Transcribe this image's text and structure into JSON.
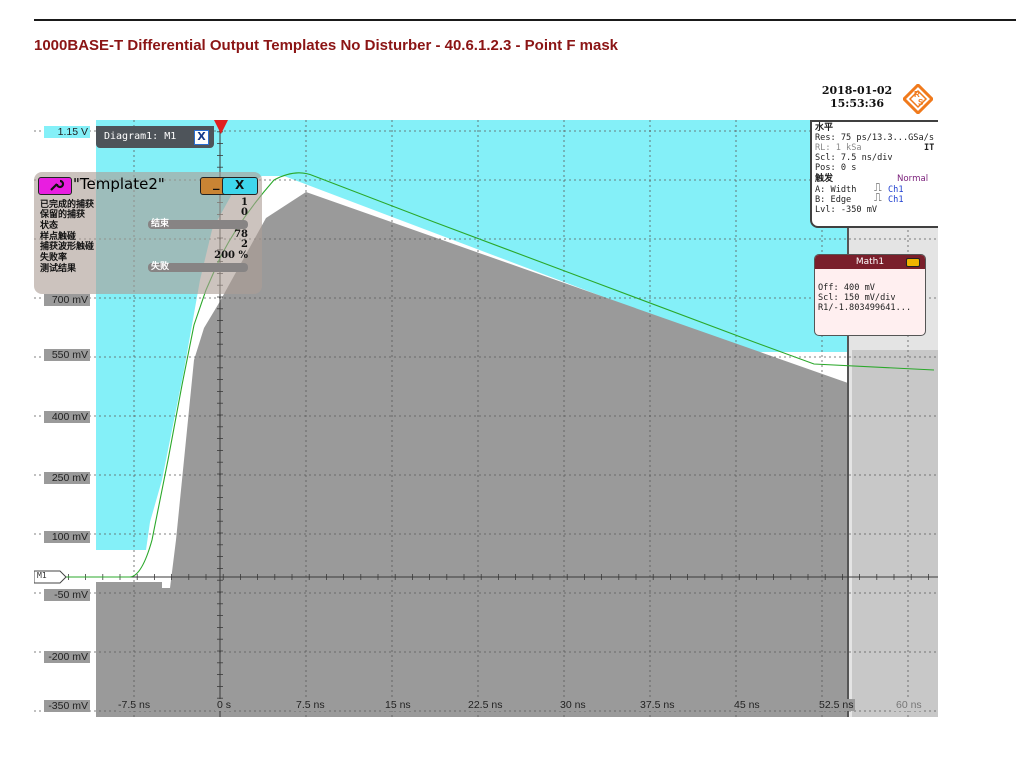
{
  "document": {
    "title": "1000BASE-T Differential Output Templates No Disturber - 40.6.1.2.3 - Point F mask"
  },
  "header": {
    "date": "2018-01-02",
    "time": "15:53:36",
    "logo_text": "RS"
  },
  "diagram_tab": {
    "label": "Diagram1: M1",
    "close_label": "X"
  },
  "template_panel": {
    "name": "\"Template2\"",
    "minimize_label": "_",
    "close_label": "X",
    "rows": [
      {
        "label": "已完成的捕获",
        "value": "1"
      },
      {
        "label": "保留的捕获",
        "value": "0"
      },
      {
        "label": "状态",
        "value": "结束",
        "is_bar": true
      },
      {
        "label": "样点触碰",
        "value": "78"
      },
      {
        "label": "捕获波形触碰",
        "value": "2"
      },
      {
        "label": "失败率",
        "value": "200 %"
      },
      {
        "label": "测试结果",
        "value": "失败",
        "is_bar": true
      }
    ]
  },
  "horizontal_panel": {
    "header": "水平",
    "res": "Res: 75 ps/13.3...GSa/s",
    "rl": "RL: 1 kSa",
    "rl_suffix": "IT",
    "scl": "Scl: 7.5 ns/div",
    "pos": "Pos: 0 s",
    "trigger_header": "触发",
    "trigger_mode": "Normal",
    "a_line": "A:  Width",
    "a_channel": "Ch1",
    "b_line": "B:  Edge",
    "b_channel": "Ch1",
    "lvl": "Lvl: -350 mV"
  },
  "math_panel": {
    "title": "Math1",
    "off": "Off: 400 mV",
    "scl": "Scl: 150 mV/div",
    "r1": "R1/-1.803499641..."
  },
  "y_axis": {
    "labels": [
      "1.15 V",
      "700 mV",
      "550 mV",
      "400 mV",
      "250 mV",
      "100 mV",
      "-50 mV",
      "-200 mV",
      "-350 mV"
    ]
  },
  "x_axis": {
    "labels": [
      "-7.5 ns",
      "0 s",
      "7.5 ns",
      "15 ns",
      "22.5 ns",
      "30 ns",
      "37.5 ns",
      "45 ns",
      "52.5 ns",
      "60 ns"
    ]
  },
  "marker": {
    "label": "M1"
  },
  "colors": {
    "mask_cyan": "#84f0f8",
    "measured_gray": "#9a9a9a",
    "trace_green": "#2ba82b",
    "grid_gray": "#5a5a5a",
    "title_red": "#8b1515",
    "trigger_red": "#e02020"
  }
}
